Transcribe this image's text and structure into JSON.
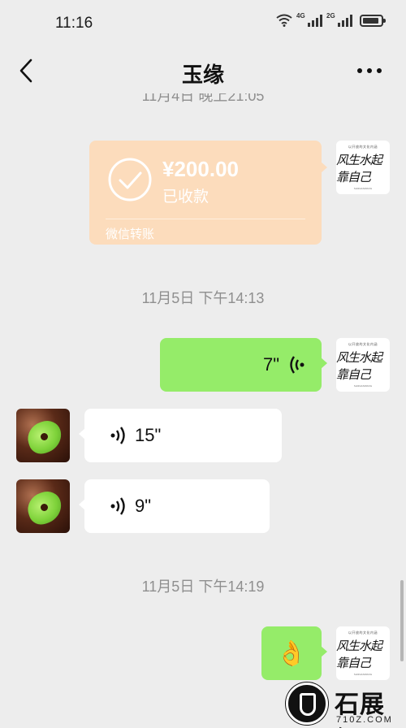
{
  "status_bar": {
    "time": "11:16",
    "network_1": "4G",
    "network_2": "2G",
    "battery_level": 0.9
  },
  "header": {
    "title": "玉缘",
    "back_icon": "chevron-left-icon",
    "more_icon": "more-horizontal-icon"
  },
  "messages": {
    "top_timestamp": "11月4日 晚上21:05",
    "transfer": {
      "amount": "¥200.00",
      "status": "已收款",
      "footer": "微信转账",
      "color": "#fcdcbc"
    },
    "timestamp_1": "11月5日 下午14:13",
    "voice_mine": {
      "duration": "7\""
    },
    "voice_theirs_1": {
      "duration": "15\""
    },
    "voice_theirs_2": {
      "duration": "9\""
    },
    "timestamp_2": "11月5日 下午14:19",
    "emoji_mine": {
      "emoji": "👌"
    }
  },
  "avatar_me": {
    "line_top": "以开放的文化内涵",
    "calligraphy": "风生水起靠自己",
    "line_bottom": "SHIZHANWANG"
  },
  "watermark": {
    "brand": "石展網",
    "url": "710Z.COM"
  },
  "colors": {
    "background": "#ededed",
    "my_bubble": "#95ec69",
    "their_bubble": "#ffffff"
  }
}
